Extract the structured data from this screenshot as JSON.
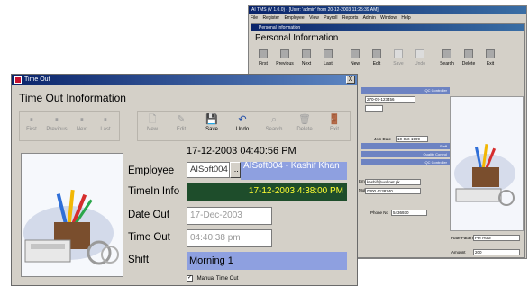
{
  "background_app": {
    "title": "AI TMS (V 1.0.0) - [User: 'admin' from 20-12-2003 11:25:39 AM]",
    "menu": [
      "File",
      "Register",
      "Employee",
      "View",
      "Payroll",
      "Reports",
      "Admin",
      "Window",
      "Help"
    ],
    "child_title": "Personal Information",
    "heading": "Personal Information",
    "toolbar": [
      "First",
      "Previous",
      "Next",
      "Last",
      "New",
      "Edit",
      "Save",
      "Undo",
      "Search",
      "Delete",
      "Exit"
    ],
    "strips": [
      "QC Controller",
      "Staff",
      "Quality Control",
      "QC Controller"
    ],
    "fields": {
      "code": "270-07-123456",
      "join_date_label": "Join Date",
      "join_date": "10-Oct-1999",
      "email_label": "Email",
      "email": "kashif@wol.net.pk",
      "mobile_label": "Mobile",
      "mobile": "0300 4138740",
      "phone_label": "Phone No",
      "phone": "5436930",
      "rate_pattern_label": "Rate Pattern",
      "rate_pattern": "Per Hour",
      "amount_label": "Amount",
      "amount": "200"
    }
  },
  "dialog": {
    "title": "Time Out",
    "heading": "Time Out Inoformation",
    "close_label": "X",
    "toolbar": {
      "first": "First",
      "previous": "Previous",
      "next": "Next",
      "last": "Last",
      "new": "New",
      "edit": "Edit",
      "save": "Save",
      "undo": "Undo",
      "search": "Search",
      "delete": "Delete",
      "exit": "Exit"
    },
    "current_datetime": "17-12-2003 04:40:56 PM",
    "employee_label": "Employee",
    "employee_code": "AISoft004",
    "browse_label": "...",
    "employee_name": "AISoft004 - Kashif Khan",
    "timein_label": "TimeIn Info",
    "timein_value": "17-12-2003 4:38:00 PM",
    "dateout_label": "Date Out",
    "dateout_value": "17-Dec-2003",
    "timeout_label": "Time Out",
    "timeout_value": "04:40:38 pm",
    "shift_label": "Shift",
    "shift_value": "Morning 1",
    "manual_label": "Manual Time Out",
    "manual_checked": true
  }
}
